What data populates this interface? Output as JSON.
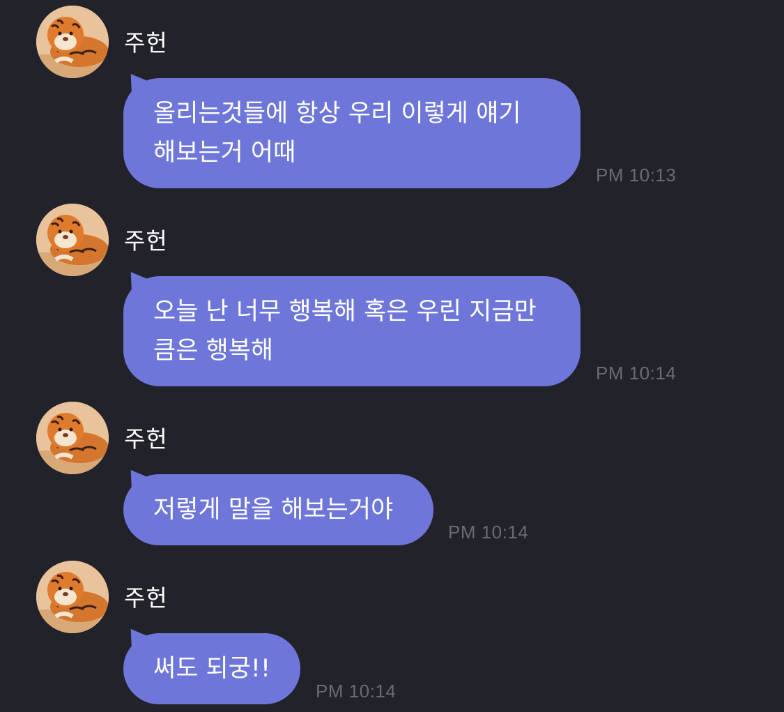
{
  "chat": {
    "messages": [
      {
        "sender": "주헌",
        "text": "올리는것들에 항상 우리 이렇게 얘기\n해보는거 어때",
        "time": "PM 10:13",
        "avatar": "tiger-avatar"
      },
      {
        "sender": "주헌",
        "text": "오늘 난 너무 행복해 혹은 우린 지금만\n큼은 행복해",
        "time": "PM 10:14",
        "avatar": "tiger-avatar"
      },
      {
        "sender": "주헌",
        "text": "저렇게 말을 해보는거야",
        "time": "PM 10:14",
        "avatar": "tiger-avatar"
      },
      {
        "sender": "주헌",
        "text": "써도 되궁!!",
        "time": "PM 10:14",
        "avatar": "tiger-avatar"
      }
    ]
  },
  "colors": {
    "background": "#22222a",
    "bubble": "#6e77d9",
    "timestamp": "#6b6b74",
    "text": "#ffffff"
  }
}
